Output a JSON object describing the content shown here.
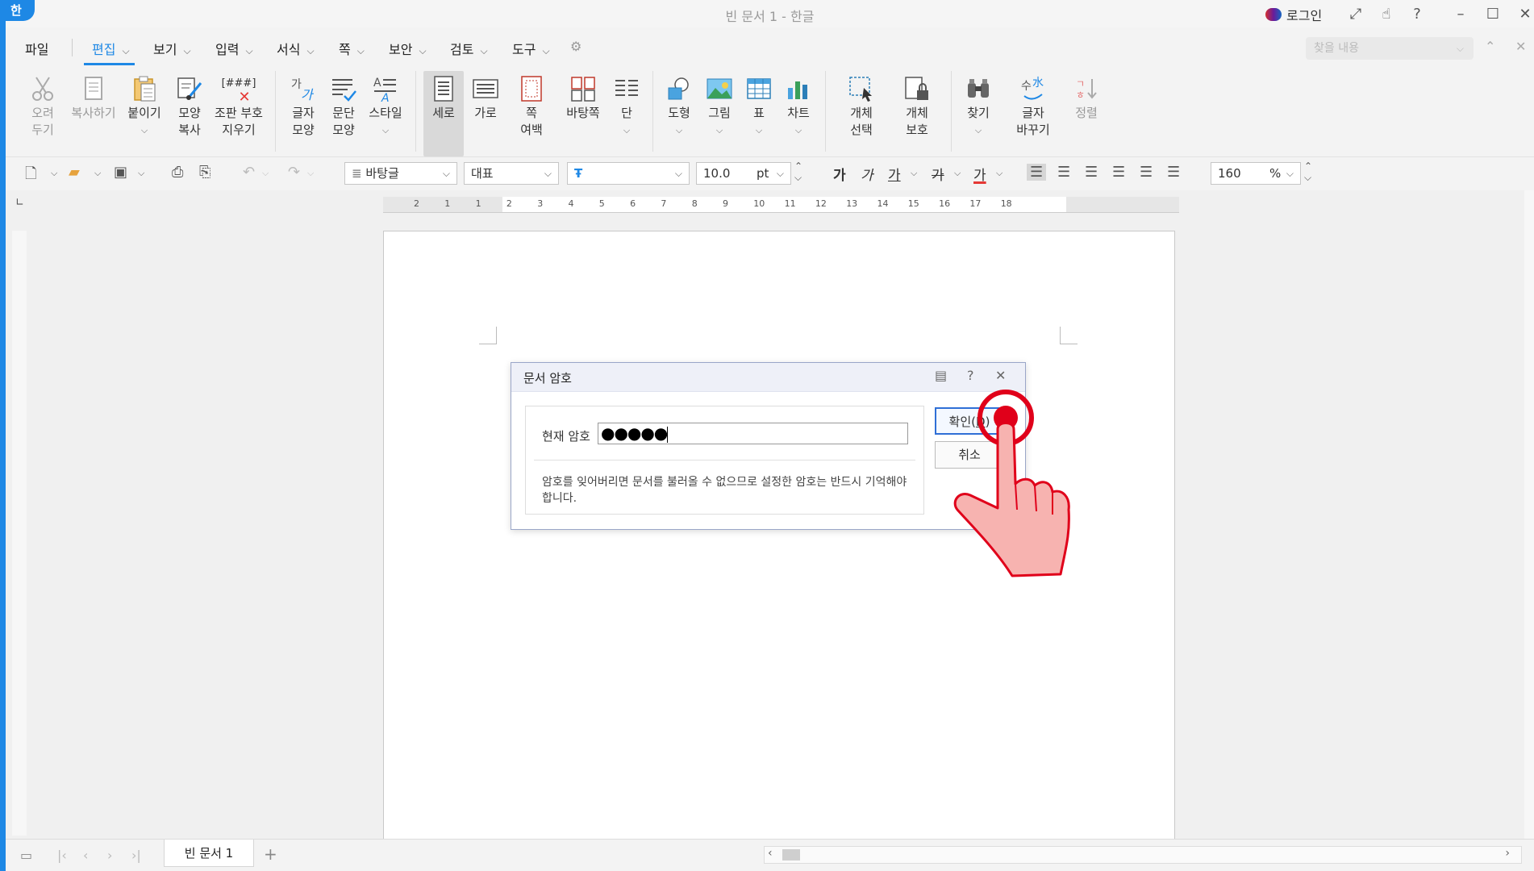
{
  "window": {
    "title": "빈 문서 1 - 한글",
    "app_badge": "한",
    "login_label": "로그인"
  },
  "menu": {
    "items": [
      "파일",
      "편집",
      "보기",
      "입력",
      "서식",
      "쪽",
      "보안",
      "검토",
      "도구"
    ],
    "active": "편집",
    "search_placeholder": "찾을 내용"
  },
  "ribbon": {
    "cut": "오려\n두기",
    "copy": "복사하기",
    "paste": "붙이기",
    "format_copy": "모양\n복사",
    "clear_marks": "조판 부호\n지우기",
    "clear_marks_icon_text": "[###]",
    "char_shape": "글자\n모양",
    "para_shape": "문단\n모양",
    "style": "스타일",
    "portrait": "세로",
    "landscape": "가로",
    "page_margin": "쪽\n여백",
    "background_page": "바탕쪽",
    "columns": "단",
    "shape": "도형",
    "picture": "그림",
    "table": "표",
    "chart": "차트",
    "object_select": "개체\n선택",
    "object_protect": "개체\n보호",
    "find": "찾기",
    "replace_chars": "글자\n바꾸기",
    "sort": "정렬"
  },
  "toolbar": {
    "style_name": "바탕글",
    "font_lang": "대표",
    "font_face": "",
    "font_size": "10.0",
    "font_unit": "pt",
    "zoom": "160",
    "zoom_unit": "%",
    "bold": "가",
    "italic": "가",
    "underline": "가",
    "strike": "가",
    "color_text": "가",
    "font_color": "#e53935",
    "align_selected": "justify"
  },
  "ruler": {
    "ticks": [
      "2",
      "1",
      "1",
      "2",
      "3",
      "4",
      "5",
      "6",
      "7",
      "8",
      "9",
      "10",
      "11",
      "12",
      "13",
      "14",
      "15",
      "16",
      "17",
      "18"
    ]
  },
  "dialog": {
    "title": "문서 암호",
    "password_label": "현재 암호",
    "password_value": "●●●●●",
    "notice": "암호를 잊어버리면 문서를 불러올 수 없으므로 설정한 암호는 반드시 기억해야 합니다.",
    "ok": "확인",
    "ok_shortcut": "D",
    "cancel": "취소"
  },
  "statusbar": {
    "doc_tab": "빈 문서 1",
    "add_tab": "+"
  },
  "colors": {
    "accent": "#1e88e5",
    "cursor_highlight": "#e0001a",
    "hand": "#f7b3b0"
  }
}
